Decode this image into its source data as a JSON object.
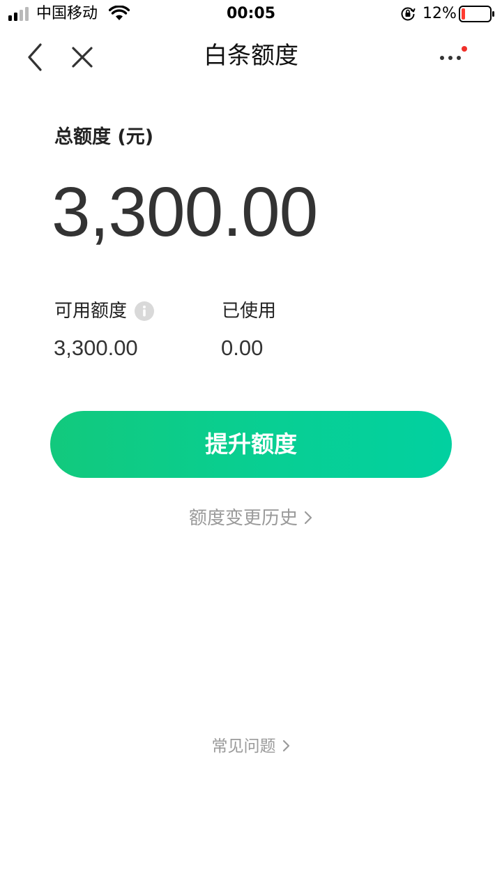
{
  "status_bar": {
    "carrier": "中国移动",
    "time": "00:05",
    "battery_percent": "12%",
    "battery_level": 0.12,
    "icons": [
      "signal-icon",
      "wifi-icon",
      "orientation-lock-icon",
      "battery-icon"
    ]
  },
  "nav": {
    "title": "白条额度",
    "icons": [
      "back-chevron-icon",
      "close-icon",
      "more-dots-icon"
    ],
    "notification_dot_color": "#f0302a"
  },
  "credit": {
    "total_label": "总额度 (元)",
    "total_amount": "3,300.00",
    "available_label": "可用额度",
    "available_value": "3,300.00",
    "used_label": "已使用",
    "used_value": "0.00"
  },
  "actions": {
    "raise_limit_label": "提升额度",
    "history_label": "额度变更历史",
    "faq_label": "常见问题"
  },
  "colors": {
    "accent_start": "#12c97d",
    "accent_end": "#02d0a0",
    "muted_text": "#9a9a9a"
  }
}
